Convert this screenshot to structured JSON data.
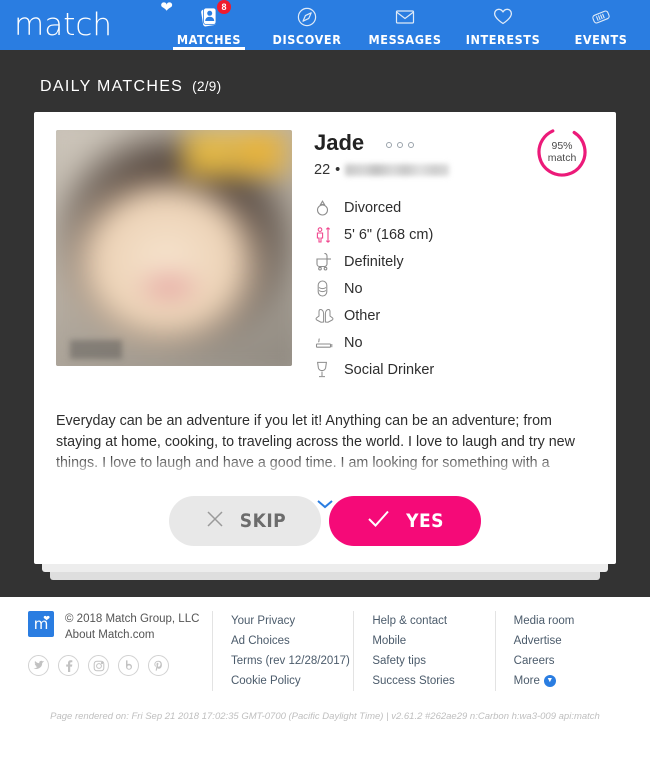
{
  "nav": {
    "logo_text": "match",
    "logo_icon": "heart-icon",
    "items": [
      {
        "label": "MATCHES",
        "icon": "matches-card-icon",
        "badge": "8",
        "active": true
      },
      {
        "label": "DISCOVER",
        "icon": "compass-icon",
        "badge": "",
        "active": false
      },
      {
        "label": "MESSAGES",
        "icon": "envelope-icon",
        "badge": "",
        "active": false
      },
      {
        "label": "INTERESTS",
        "icon": "heart-outline-icon",
        "badge": "",
        "active": false
      },
      {
        "label": "EVENTS",
        "icon": "ticket-icon",
        "badge": "",
        "active": false
      }
    ]
  },
  "section": {
    "title": "DAILY MATCHES",
    "count": "(2/9)"
  },
  "profile": {
    "name": "Jade",
    "age": "22",
    "separator": "•",
    "location": "",
    "menu_icon": "more-options-icon",
    "match_percent": "95%",
    "match_label": "match",
    "photo_alt": "profile-photo",
    "attributes": [
      {
        "icon": "ring-icon",
        "value": "Divorced"
      },
      {
        "icon": "height-icon",
        "value": "5' 6\" (168 cm)"
      },
      {
        "icon": "stroller-icon",
        "value": "Definitely"
      },
      {
        "icon": "body-type-icon",
        "value": "No"
      },
      {
        "icon": "praying-hands-icon",
        "value": "Other"
      },
      {
        "icon": "cigarette-icon",
        "value": "No"
      },
      {
        "icon": "wine-glass-icon",
        "value": "Social Drinker"
      }
    ],
    "bio": "Everyday can be an adventure if you let it! Anything can be an adventure; from staying at home, cooking, to traveling across the world. I love to laugh and try new things. I love to laugh and have a good time. I am looking for something with a",
    "expand_icon": "chevron-down-icon"
  },
  "actions": {
    "skip_label": "SKIP",
    "skip_icon": "close-x-icon",
    "yes_label": "YES",
    "yes_icon": "check-icon"
  },
  "footer": {
    "logo_letter": "m",
    "copyright": "© 2018 Match Group, LLC",
    "about": "About Match.com",
    "socials": [
      {
        "icon": "twitter-icon",
        "glyph": "✒"
      },
      {
        "icon": "facebook-icon",
        "glyph": "f"
      },
      {
        "icon": "instagram-icon",
        "glyph": "▣"
      },
      {
        "icon": "blog-icon",
        "glyph": "b"
      },
      {
        "icon": "pinterest-icon",
        "glyph": "ⓟ"
      }
    ],
    "col1": [
      "Your Privacy",
      "Ad Choices",
      "Terms (rev 12/28/2017)",
      "Cookie Policy"
    ],
    "col2": [
      "Help & contact",
      "Mobile",
      "Safety tips",
      "Success Stories"
    ],
    "col3": [
      "Media room",
      "Advertise",
      "Careers",
      "More"
    ],
    "more_icon": "chevron-down-circle-icon",
    "rendered": "Page rendered on: Fri Sep 21 2018 17:02:35 GMT-0700 (Pacific Daylight Time) | v2.61.2 #262ae29 n:Carbon h:wa3-009 api:match"
  },
  "colors": {
    "brand_blue": "#2a7de1",
    "accent_pink": "#f50a78",
    "badge_red": "#ef1b2d",
    "stage_dark": "#333333"
  }
}
